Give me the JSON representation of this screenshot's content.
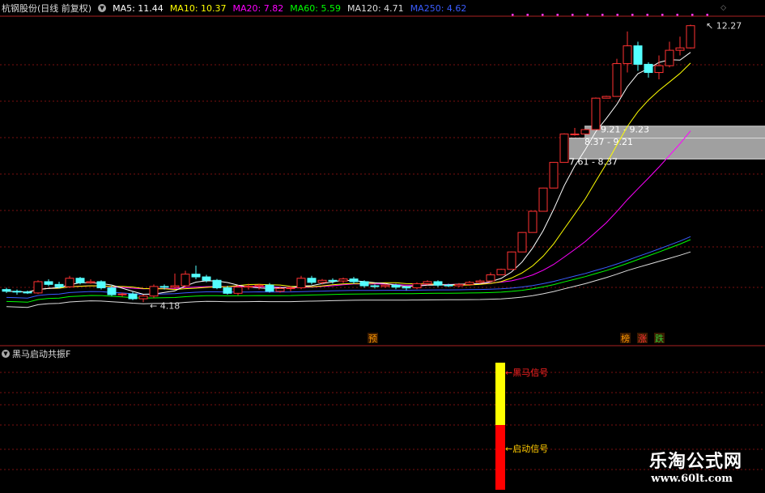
{
  "header": {
    "stock": "杭钢股份(日线 前复权)",
    "ma_items": [
      {
        "label": "MA5: 11.44",
        "color": "#ffffff"
      },
      {
        "label": "MA10: 10.37",
        "color": "#ffff00"
      },
      {
        "label": "MA20: 7.82",
        "color": "#ff00ff"
      },
      {
        "label": "MA60: 5.59",
        "color": "#00ff00"
      },
      {
        "label": "MA120: 4.71",
        "color": "#dddddd"
      },
      {
        "label": "MA250: 4.62",
        "color": "#3a5cff"
      }
    ]
  },
  "indicator": {
    "title": "黑马启动共振F",
    "signal_top_label": "黑马信号",
    "signal_bottom_label": "启动信号"
  },
  "annotations": {
    "low_label": "4.18",
    "high_label": "12.27",
    "zones": [
      "9.21 - 9.23",
      "8.37 - 9.21",
      "7.61 - 8.37"
    ],
    "tags": [
      {
        "text": "预",
        "color": "#ff9900"
      },
      {
        "text": "榜",
        "color": "#ff9900"
      },
      {
        "text": "涨",
        "color": "#ff3333"
      },
      {
        "text": "跌",
        "color": "#33cc33"
      }
    ]
  },
  "watermark": {
    "cn": "乐淘公式网",
    "url": "www.60lt.com"
  },
  "chart_data": {
    "type": "candlestick",
    "colors": {
      "up": "#ff3232",
      "down": "#54ffff",
      "signal_top": "#ffff00",
      "signal_bottom": "#ff0000"
    },
    "y_scale": {
      "min": 3.5,
      "max": 12.5
    },
    "candles": [
      [
        4.55,
        4.5,
        4.6,
        4.45
      ],
      [
        4.5,
        4.48,
        4.55,
        4.4
      ],
      [
        4.48,
        4.45,
        4.52,
        4.42
      ],
      [
        4.45,
        4.78,
        4.82,
        4.42
      ],
      [
        4.78,
        4.7,
        4.85,
        4.65
      ],
      [
        4.7,
        4.63,
        4.78,
        4.58
      ],
      [
        4.63,
        4.88,
        4.95,
        4.6
      ],
      [
        4.88,
        4.75,
        4.92,
        4.7
      ],
      [
        4.75,
        4.78,
        4.85,
        4.72
      ],
      [
        4.78,
        4.6,
        4.82,
        4.55
      ],
      [
        4.6,
        4.4,
        4.66,
        4.36
      ],
      [
        4.4,
        4.42,
        4.46,
        4.34
      ],
      [
        4.42,
        4.28,
        4.48,
        4.24
      ],
      [
        4.28,
        4.36,
        4.4,
        4.18
      ],
      [
        4.36,
        4.64,
        4.7,
        4.3
      ],
      [
        4.64,
        4.62,
        4.7,
        4.55
      ],
      [
        4.62,
        4.66,
        5.02,
        4.56
      ],
      [
        4.66,
        5.0,
        5.1,
        4.6
      ],
      [
        5.0,
        4.92,
        5.25,
        4.85
      ],
      [
        4.92,
        4.82,
        4.98,
        4.76
      ],
      [
        4.82,
        4.6,
        4.86,
        4.56
      ],
      [
        4.6,
        4.44,
        4.66,
        4.4
      ],
      [
        4.44,
        4.62,
        4.68,
        4.38
      ],
      [
        4.62,
        4.65,
        4.72,
        4.55
      ],
      [
        4.65,
        4.68,
        4.72,
        4.55
      ],
      [
        4.68,
        4.5,
        4.74,
        4.46
      ],
      [
        4.5,
        4.58,
        4.64,
        4.46
      ],
      [
        4.58,
        4.6,
        4.65,
        4.5
      ],
      [
        4.6,
        4.88,
        4.95,
        4.56
      ],
      [
        4.88,
        4.76,
        4.95,
        4.7
      ],
      [
        4.76,
        4.82,
        4.86,
        4.7
      ],
      [
        4.82,
        4.8,
        4.88,
        4.72
      ],
      [
        4.8,
        4.86,
        4.9,
        4.74
      ],
      [
        4.86,
        4.78,
        4.92,
        4.72
      ],
      [
        4.78,
        4.66,
        4.82,
        4.6
      ],
      [
        4.66,
        4.64,
        4.7,
        4.58
      ],
      [
        4.64,
        4.68,
        4.72,
        4.6
      ],
      [
        4.68,
        4.62,
        4.72,
        4.56
      ],
      [
        4.62,
        4.6,
        4.66,
        4.52
      ],
      [
        4.6,
        4.72,
        4.76,
        4.56
      ],
      [
        4.72,
        4.78,
        4.82,
        4.68
      ],
      [
        4.78,
        4.68,
        4.82,
        4.62
      ],
      [
        4.68,
        4.66,
        4.72,
        4.62
      ],
      [
        4.66,
        4.7,
        4.74,
        4.62
      ],
      [
        4.7,
        4.76,
        4.8,
        4.66
      ],
      [
        4.76,
        4.8,
        4.84,
        4.72
      ],
      [
        4.8,
        4.98,
        5.05,
        4.76
      ],
      [
        4.98,
        5.14,
        5.16,
        5.1
      ],
      [
        5.14,
        5.65,
        5.66,
        5.64
      ],
      [
        5.65,
        6.22,
        6.23,
        6.21
      ],
      [
        6.22,
        6.84,
        6.85,
        6.83
      ],
      [
        6.84,
        7.52,
        7.53,
        7.51
      ],
      [
        7.52,
        8.27,
        8.28,
        8.26
      ],
      [
        8.27,
        9.1,
        9.12,
        9.08
      ],
      [
        9.1,
        9.1,
        9.28,
        9.05
      ],
      [
        9.1,
        9.23,
        9.25,
        9.21
      ],
      [
        9.23,
        10.15,
        10.17,
        10.13
      ],
      [
        10.15,
        10.2,
        10.22,
        10.18
      ],
      [
        10.2,
        11.16,
        11.3,
        10.8
      ],
      [
        11.16,
        11.68,
        12.1,
        10.9
      ],
      [
        11.68,
        11.14,
        11.8,
        10.95
      ],
      [
        11.14,
        10.9,
        11.2,
        10.75
      ],
      [
        10.9,
        11.1,
        11.4,
        10.7
      ],
      [
        11.1,
        11.55,
        11.8,
        11.05
      ],
      [
        11.55,
        11.62,
        11.95,
        11.4
      ],
      [
        11.62,
        12.27,
        12.3,
        11.6
      ]
    ]
  }
}
